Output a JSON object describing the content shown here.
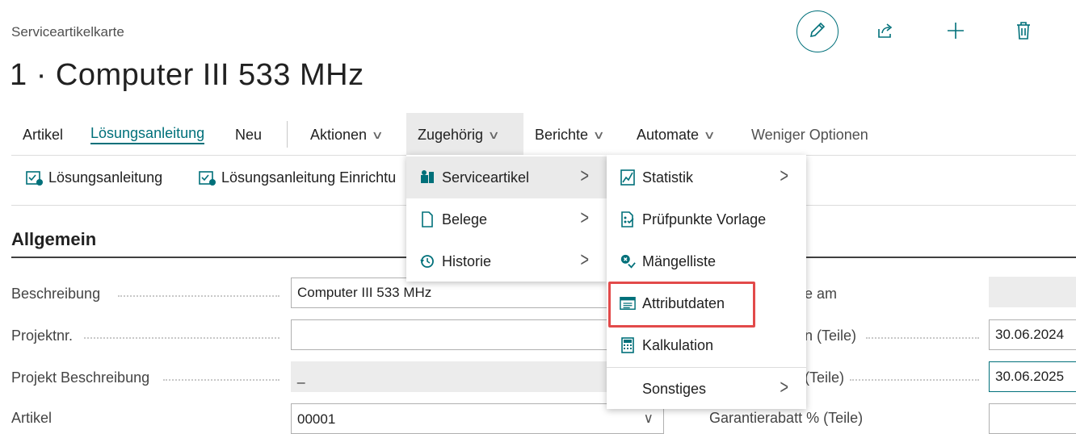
{
  "header": {
    "breadcrumb": "Serviceartikelkarte",
    "title": "1 · Computer III 533 MHz"
  },
  "toolbar_icons": [
    "edit-icon",
    "share-icon",
    "add-icon",
    "delete-icon"
  ],
  "actionbar": {
    "artikel": "Artikel",
    "loesungsanleitung": "Lösungsanleitung",
    "neu": "Neu",
    "aktionen": "Aktionen",
    "zugehoerig": "Zugehörig",
    "berichte": "Berichte",
    "automate": "Automate",
    "weniger": "Weniger Optionen"
  },
  "subactions": {
    "item1": "Lösungsanleitung",
    "item2": "Lösungsanleitung Einrichtu"
  },
  "section": {
    "title": "Allgemein"
  },
  "fields": {
    "beschreibung": {
      "label": "Beschreibung",
      "value": "Computer III 533 MHz"
    },
    "projektnr": {
      "label": "Projektnr.",
      "value": ""
    },
    "projekt_beschreibung": {
      "label": "Projekt Beschreibung",
      "value": "_"
    },
    "artikel": {
      "label": "Artikel",
      "value": "00001"
    }
  },
  "right_fields": {
    "r1": {
      "label": "e am",
      "value": ""
    },
    "r2": {
      "label": "n (Teile)",
      "value": "30.06.2024"
    },
    "r3": {
      "label": "(Teile)",
      "value": "30.06.2025"
    },
    "r4": {
      "label": "Garantierabatt % (Teile)",
      "value": ""
    }
  },
  "menu_level1": {
    "serviceartikel": "Serviceartikel",
    "belege": "Belege",
    "historie": "Historie"
  },
  "menu_level2": {
    "statistik": "Statistik",
    "pruefpunkte": "Prüfpunkte Vorlage",
    "maengelliste": "Mängelliste",
    "attributdaten": "Attributdaten",
    "kalkulation": "Kalkulation",
    "sonstiges": "Sonstiges"
  },
  "colors": {
    "accent": "#00707a",
    "highlight": "#e24a4a"
  }
}
